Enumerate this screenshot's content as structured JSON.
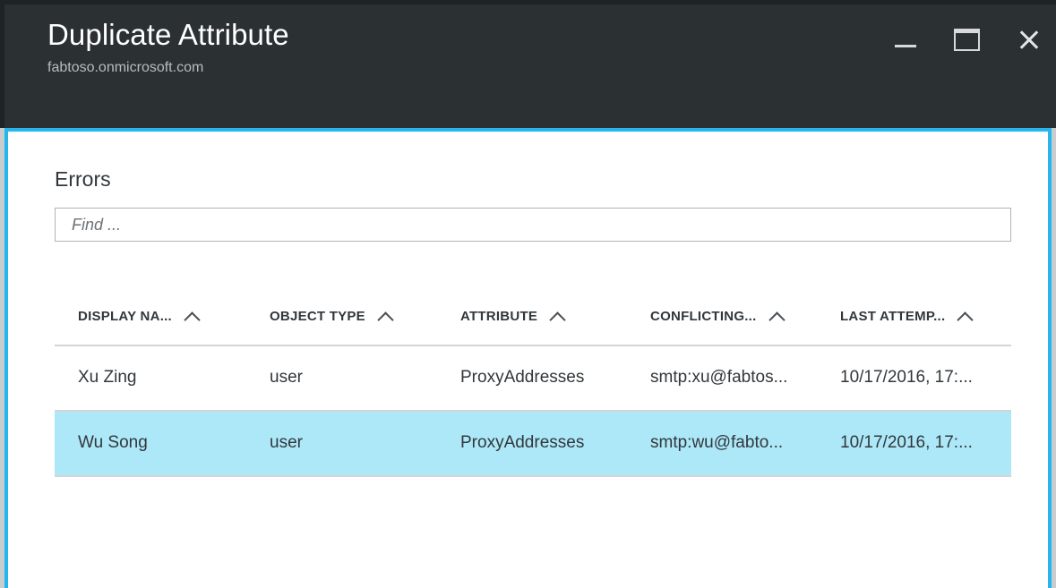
{
  "window": {
    "title": "Duplicate Attribute",
    "subtitle": "fabtoso.onmicrosoft.com",
    "accent_color": "#24b6ec",
    "titlebar_color": "#2b3033",
    "selected_row_color": "#ade8f8",
    "controls": {
      "minimize": "minimize-icon",
      "maximize": "maximize-icon",
      "close": "close-icon"
    }
  },
  "content": {
    "section_title": "Errors",
    "search": {
      "placeholder": "Find ...",
      "value": ""
    },
    "table": {
      "sort_icon": "chevron-up-icon",
      "columns": [
        {
          "label": "DISPLAY NA...",
          "sortable": true
        },
        {
          "label": "OBJECT TYPE",
          "sortable": true
        },
        {
          "label": "ATTRIBUTE",
          "sortable": true
        },
        {
          "label": "CONFLICTING...",
          "sortable": true
        },
        {
          "label": "LAST ATTEMP...",
          "sortable": true
        }
      ],
      "rows": [
        {
          "display_name": "Xu Zing",
          "object_type": "user",
          "attribute": "ProxyAddresses",
          "conflicting": "smtp:xu@fabtos...",
          "last_attempt": "10/17/2016, 17:...",
          "selected": false
        },
        {
          "display_name": "Wu Song",
          "object_type": "user",
          "attribute": "ProxyAddresses",
          "conflicting": "smtp:wu@fabto...",
          "last_attempt": "10/17/2016, 17:...",
          "selected": true
        }
      ]
    }
  }
}
